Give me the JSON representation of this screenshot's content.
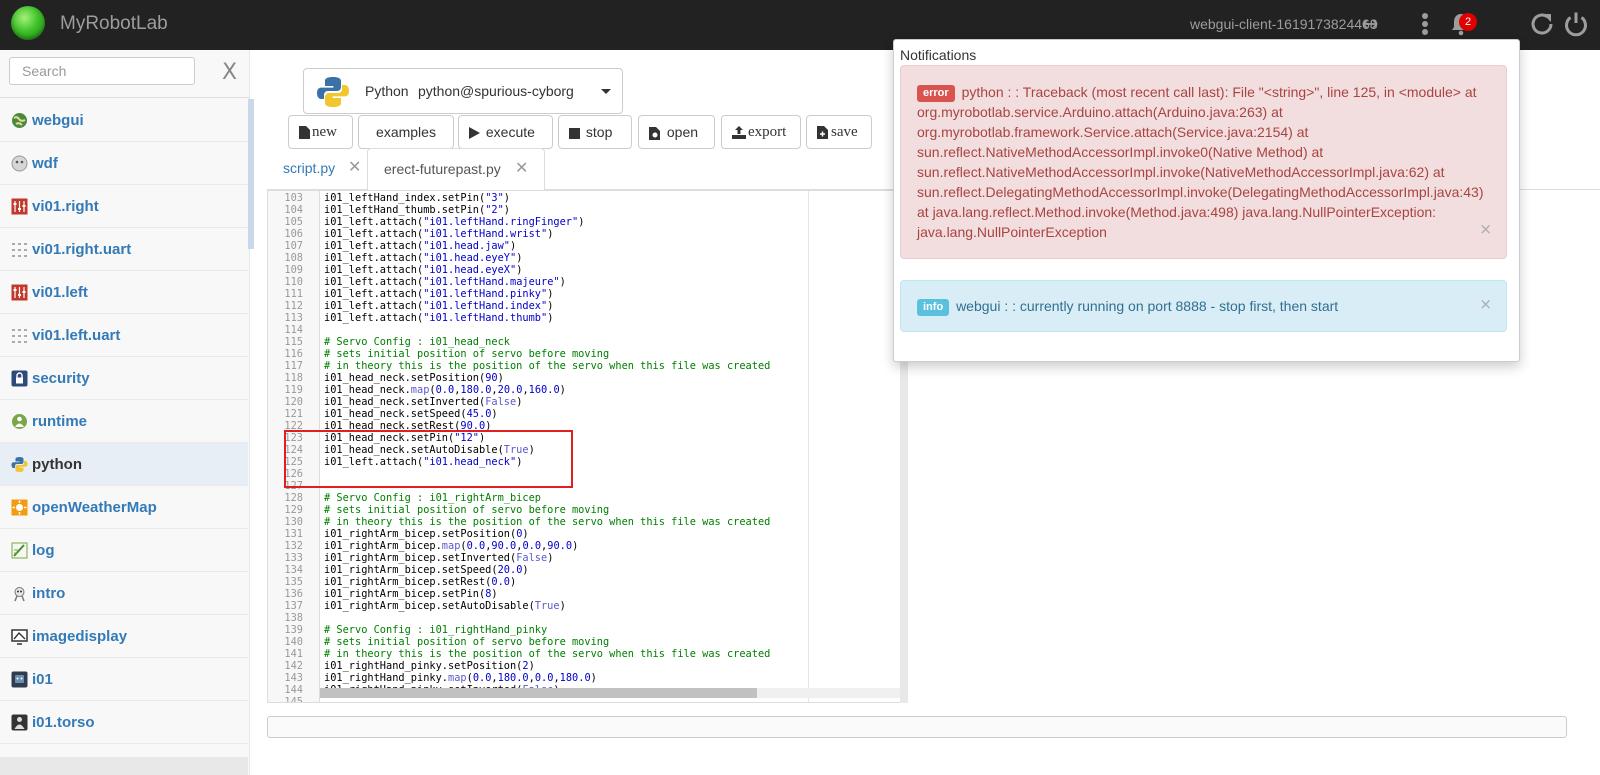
{
  "app": {
    "brand": "MyRobotLab",
    "client_id": "webgui-client-1619173824468",
    "notification_count": "2"
  },
  "sidebar": {
    "search_placeholder": "Search",
    "close_label": "X",
    "items": [
      {
        "label": "webgui",
        "icon": "globe-icon"
      },
      {
        "label": "wdf",
        "icon": "watchdog-icon"
      },
      {
        "label": "vi01.right",
        "icon": "servo-controller-icon"
      },
      {
        "label": "vi01.right.uart",
        "icon": "serial-icon"
      },
      {
        "label": "vi01.left",
        "icon": "servo-controller-icon"
      },
      {
        "label": "vi01.left.uart",
        "icon": "serial-icon"
      },
      {
        "label": "security",
        "icon": "lock-icon"
      },
      {
        "label": "runtime",
        "icon": "runtime-icon"
      },
      {
        "label": "python",
        "icon": "python-icon"
      },
      {
        "label": "openWeatherMap",
        "icon": "sun-icon"
      },
      {
        "label": "log",
        "icon": "log-icon"
      },
      {
        "label": "intro",
        "icon": "intro-icon"
      },
      {
        "label": "imagedisplay",
        "icon": "image-display-icon"
      },
      {
        "label": "i01",
        "icon": "robot-icon"
      },
      {
        "label": "i01.torso",
        "icon": "torso-icon"
      }
    ]
  },
  "service": {
    "type": "Python",
    "name": "python@spurious-cyborg"
  },
  "toolbar": {
    "new": "new",
    "examples": "examples",
    "execute": "execute",
    "stop": "stop",
    "open": "open",
    "export": "export",
    "save": "save"
  },
  "tabs": [
    {
      "label": "script.py",
      "close": "✕"
    },
    {
      "label": "erect-futurepast.py",
      "close": "✕"
    }
  ],
  "editor": {
    "lines": [
      {
        "n": "103",
        "code": "i01_leftHand_index.setPin(\"3\")"
      },
      {
        "n": "104",
        "code": "i01_leftHand_thumb.setPin(\"2\")"
      },
      {
        "n": "105",
        "code": "i01_left.attach(\"i01.leftHand.ringFinger\")"
      },
      {
        "n": "106",
        "code": "i01_left.attach(\"i01.leftHand.wrist\")"
      },
      {
        "n": "107",
        "code": "i01_left.attach(\"i01.head.jaw\")"
      },
      {
        "n": "108",
        "code": "i01_left.attach(\"i01.head.eyeY\")"
      },
      {
        "n": "109",
        "code": "i01_left.attach(\"i01.head.eyeX\")"
      },
      {
        "n": "110",
        "code": "i01_left.attach(\"i01.leftHand.majeure\")"
      },
      {
        "n": "111",
        "code": "i01_left.attach(\"i01.leftHand.pinky\")"
      },
      {
        "n": "112",
        "code": "i01_left.attach(\"i01.leftHand.index\")"
      },
      {
        "n": "113",
        "code": "i01_left.attach(\"i01.leftHand.thumb\")"
      },
      {
        "n": "114",
        "code": ""
      },
      {
        "n": "115",
        "code": "# Servo Config : i01_head_neck"
      },
      {
        "n": "116",
        "code": "# sets initial position of servo before moving"
      },
      {
        "n": "117",
        "code": "# in theory this is the position of the servo when this file was created"
      },
      {
        "n": "118",
        "code": "i01_head_neck.setPosition(90)"
      },
      {
        "n": "119",
        "code": "i01_head_neck.map(0.0,180.0,20.0,160.0)"
      },
      {
        "n": "120",
        "code": "i01_head_neck.setInverted(False)"
      },
      {
        "n": "121",
        "code": "i01_head_neck.setSpeed(45.0)"
      },
      {
        "n": "122",
        "code": "i01_head_neck.setRest(90.0)"
      },
      {
        "n": "123",
        "code": "i01_head_neck.setPin(\"12\")"
      },
      {
        "n": "124",
        "code": "i01_head_neck.setAutoDisable(True)"
      },
      {
        "n": "125",
        "code": "i01_left.attach(\"i01.head_neck\")"
      },
      {
        "n": "126",
        "code": ""
      },
      {
        "n": "127",
        "code": ""
      },
      {
        "n": "128",
        "code": "# Servo Config : i01_rightArm_bicep"
      },
      {
        "n": "129",
        "code": "# sets initial position of servo before moving"
      },
      {
        "n": "130",
        "code": "# in theory this is the position of the servo when this file was created"
      },
      {
        "n": "131",
        "code": "i01_rightArm_bicep.setPosition(0)"
      },
      {
        "n": "132",
        "code": "i01_rightArm_bicep.map(0.0,90.0,0.0,90.0)"
      },
      {
        "n": "133",
        "code": "i01_rightArm_bicep.setInverted(False)"
      },
      {
        "n": "134",
        "code": "i01_rightArm_bicep.setSpeed(20.0)"
      },
      {
        "n": "135",
        "code": "i01_rightArm_bicep.setRest(0.0)"
      },
      {
        "n": "136",
        "code": "i01_rightArm_bicep.setPin(8)"
      },
      {
        "n": "137",
        "code": "i01_rightArm_bicep.setAutoDisable(True)"
      },
      {
        "n": "138",
        "code": ""
      },
      {
        "n": "139",
        "code": "# Servo Config : i01_rightHand_pinky"
      },
      {
        "n": "140",
        "code": "# sets initial position of servo before moving"
      },
      {
        "n": "141",
        "code": "# in theory this is the position of the servo when this file was created"
      },
      {
        "n": "142",
        "code": "i01_rightHand_pinky.setPosition(2)"
      },
      {
        "n": "143",
        "code": "i01_rightHand_pinky.map(0.0,180.0,0.0,180.0)"
      },
      {
        "n": "144",
        "code": "i01_rightHand_pinky.setInverted(False)"
      },
      {
        "n": "145",
        "code": ""
      }
    ]
  },
  "notifications": {
    "title": "Notifications",
    "items": [
      {
        "level": "error",
        "text": "python : : Traceback (most recent call last): File \"<string>\", line 125, in <module> at org.myrobotlab.service.Arduino.attach(Arduino.java:263) at org.myrobotlab.framework.Service.attach(Service.java:2154) at sun.reflect.NativeMethodAccessorImpl.invoke0(Native Method) at sun.reflect.NativeMethodAccessorImpl.invoke(NativeMethodAccessorImpl.java:62) at sun.reflect.DelegatingMethodAccessorImpl.invoke(DelegatingMethodAccessorImpl.java:43) at java.lang.reflect.Method.invoke(Method.java:498) java.lang.NullPointerException: java.lang.NullPointerException",
        "close": "×"
      },
      {
        "level": "info",
        "text": "webgui : : currently running on port 8888 - stop first, then start",
        "close": "×"
      }
    ]
  },
  "colors": {
    "topbar": "#222222",
    "link": "#337ab7",
    "error_bg": "#f2dede",
    "info_bg": "#d9edf7",
    "badge": "#e00000",
    "highlight": "#e02020"
  }
}
